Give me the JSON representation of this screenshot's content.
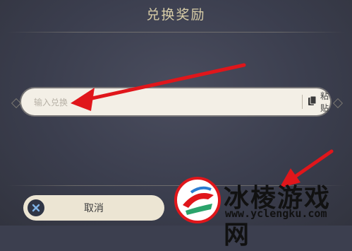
{
  "dialog": {
    "title": "兑换奖励",
    "code_input": {
      "placeholder": "输入兑换",
      "value": ""
    },
    "paste_button_label": "粘贴",
    "cancel_button_label": "取消"
  },
  "watermark": {
    "text": "冰棱游戏网",
    "url": "www.yclengku.com"
  },
  "colors": {
    "background": "#3c3f4f",
    "title": "#d8cda7",
    "input_bg": "#f3efe6",
    "cancel_bg": "#ece5d3",
    "arrow": "#e0161b"
  }
}
